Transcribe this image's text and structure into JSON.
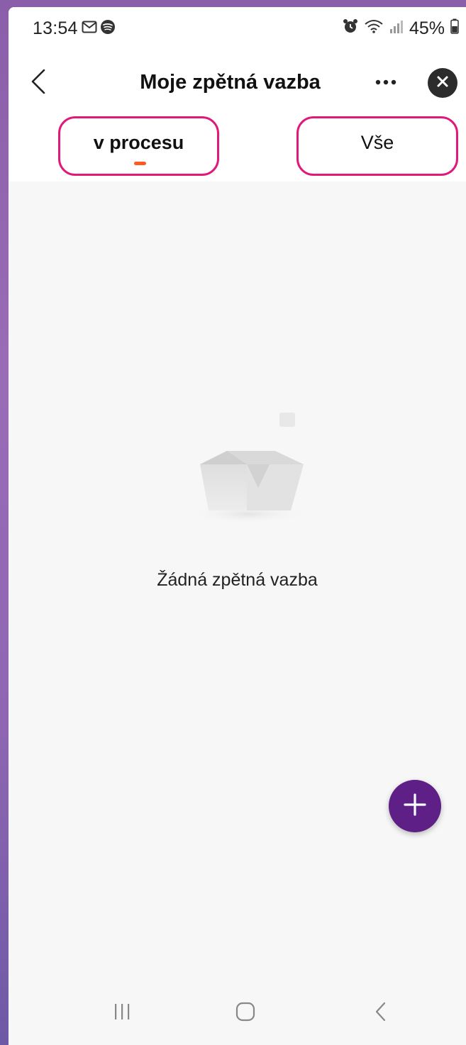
{
  "status_bar": {
    "time": "13:54",
    "battery": "45%",
    "icons_left": [
      "gmail-icon",
      "spotify-icon"
    ],
    "icons_right": [
      "alarm-icon",
      "wifi-icon",
      "signal-icon",
      "battery-icon"
    ]
  },
  "header": {
    "title": "Moje zpětná vazba",
    "back_icon": "chevron-left-icon",
    "more_icon": "more-horizontal-icon",
    "close_icon": "close-icon"
  },
  "tabs": [
    {
      "label": "v procesu",
      "active": true
    },
    {
      "label": "Vše",
      "active": false
    }
  ],
  "empty_state": {
    "text": "Žádná zpětná vazba",
    "illustration": "empty-box-icon"
  },
  "fab": {
    "icon": "plus-icon",
    "color": "#5e1f86"
  },
  "nav_bar": {
    "items": [
      "recent-apps-icon",
      "home-icon",
      "back-icon"
    ]
  },
  "colors": {
    "highlight_outline": "#e0197a",
    "tab_indicator": "#ff5a1f",
    "background": "#f7f7f7"
  }
}
